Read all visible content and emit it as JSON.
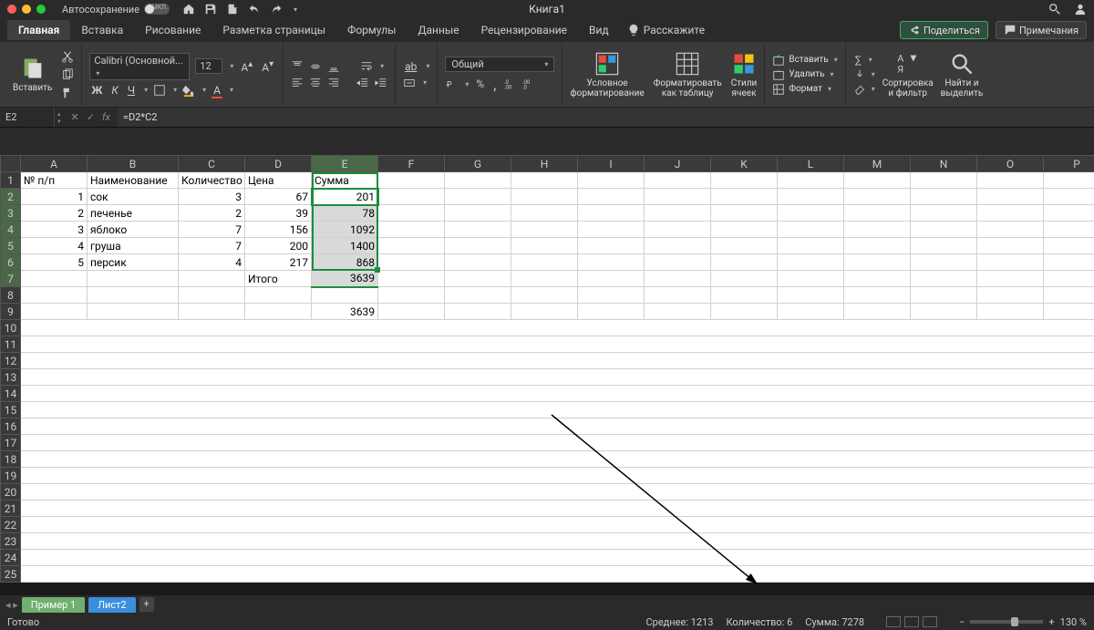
{
  "titlebar": {
    "autosave_label": "Автосохранение",
    "autosave_state": "ВЫКЛ.",
    "doc_title": "Книга1"
  },
  "ribbon_tabs": {
    "home": "Главная",
    "insert": "Вставка",
    "draw": "Рисование",
    "layout": "Разметка страницы",
    "formulas": "Формулы",
    "data": "Данные",
    "review": "Рецензирование",
    "view": "Вид",
    "tell_me": "Расскажите",
    "share": "Поделиться",
    "comments": "Примечания"
  },
  "ribbon": {
    "paste": "Вставить",
    "font_name": "Calibri (Основной...",
    "font_size": "12",
    "bold": "Ж",
    "italic": "К",
    "underline": "Ч",
    "number_format": "Общий",
    "cond_fmt_l1": "Условное",
    "cond_fmt_l2": "форматирование",
    "fmt_table_l1": "Форматировать",
    "fmt_table_l2": "как таблицу",
    "cell_styles_l1": "Стили",
    "cell_styles_l2": "ячеек",
    "insert_btn": "Вставить",
    "delete_btn": "Удалить",
    "format_btn": "Формат",
    "sort_l1": "Сортировка",
    "sort_l2": "и фильтр",
    "find_l1": "Найти и",
    "find_l2": "выделить"
  },
  "formula_bar": {
    "cell_ref": "E2",
    "fx": "fx",
    "formula": "=D2*C2"
  },
  "columns": [
    "A",
    "B",
    "C",
    "D",
    "E",
    "F",
    "G",
    "H",
    "I",
    "J",
    "K",
    "L",
    "M",
    "N",
    "O",
    "P"
  ],
  "cells": {
    "headers": {
      "A1": "№ п/п",
      "B1": "Наименование",
      "C1": "Количество",
      "D1": "Цена",
      "E1": "Сумма"
    },
    "rows": [
      {
        "A": "1",
        "B": "сок",
        "C": "3",
        "D": "67",
        "E": "201"
      },
      {
        "A": "2",
        "B": "печенье",
        "C": "2",
        "D": "39",
        "E": "78"
      },
      {
        "A": "3",
        "B": "яблоко",
        "C": "7",
        "D": "156",
        "E": "1092"
      },
      {
        "A": "4",
        "B": "груша",
        "C": "7",
        "D": "200",
        "E": "1400"
      },
      {
        "A": "5",
        "B": "персик",
        "C": "4",
        "D": "217",
        "E": "868"
      }
    ],
    "total_label": "Итого",
    "total_value": "3639",
    "e9": "3639"
  },
  "sheets": {
    "tab1": "Пример 1",
    "tab2": "Лист2"
  },
  "status": {
    "ready": "Готово",
    "avg_label": "Среднее:",
    "avg_val": "1213",
    "count_label": "Количество:",
    "count_val": "6",
    "sum_label": "Сумма:",
    "sum_val": "7278",
    "zoom": "130 %"
  }
}
